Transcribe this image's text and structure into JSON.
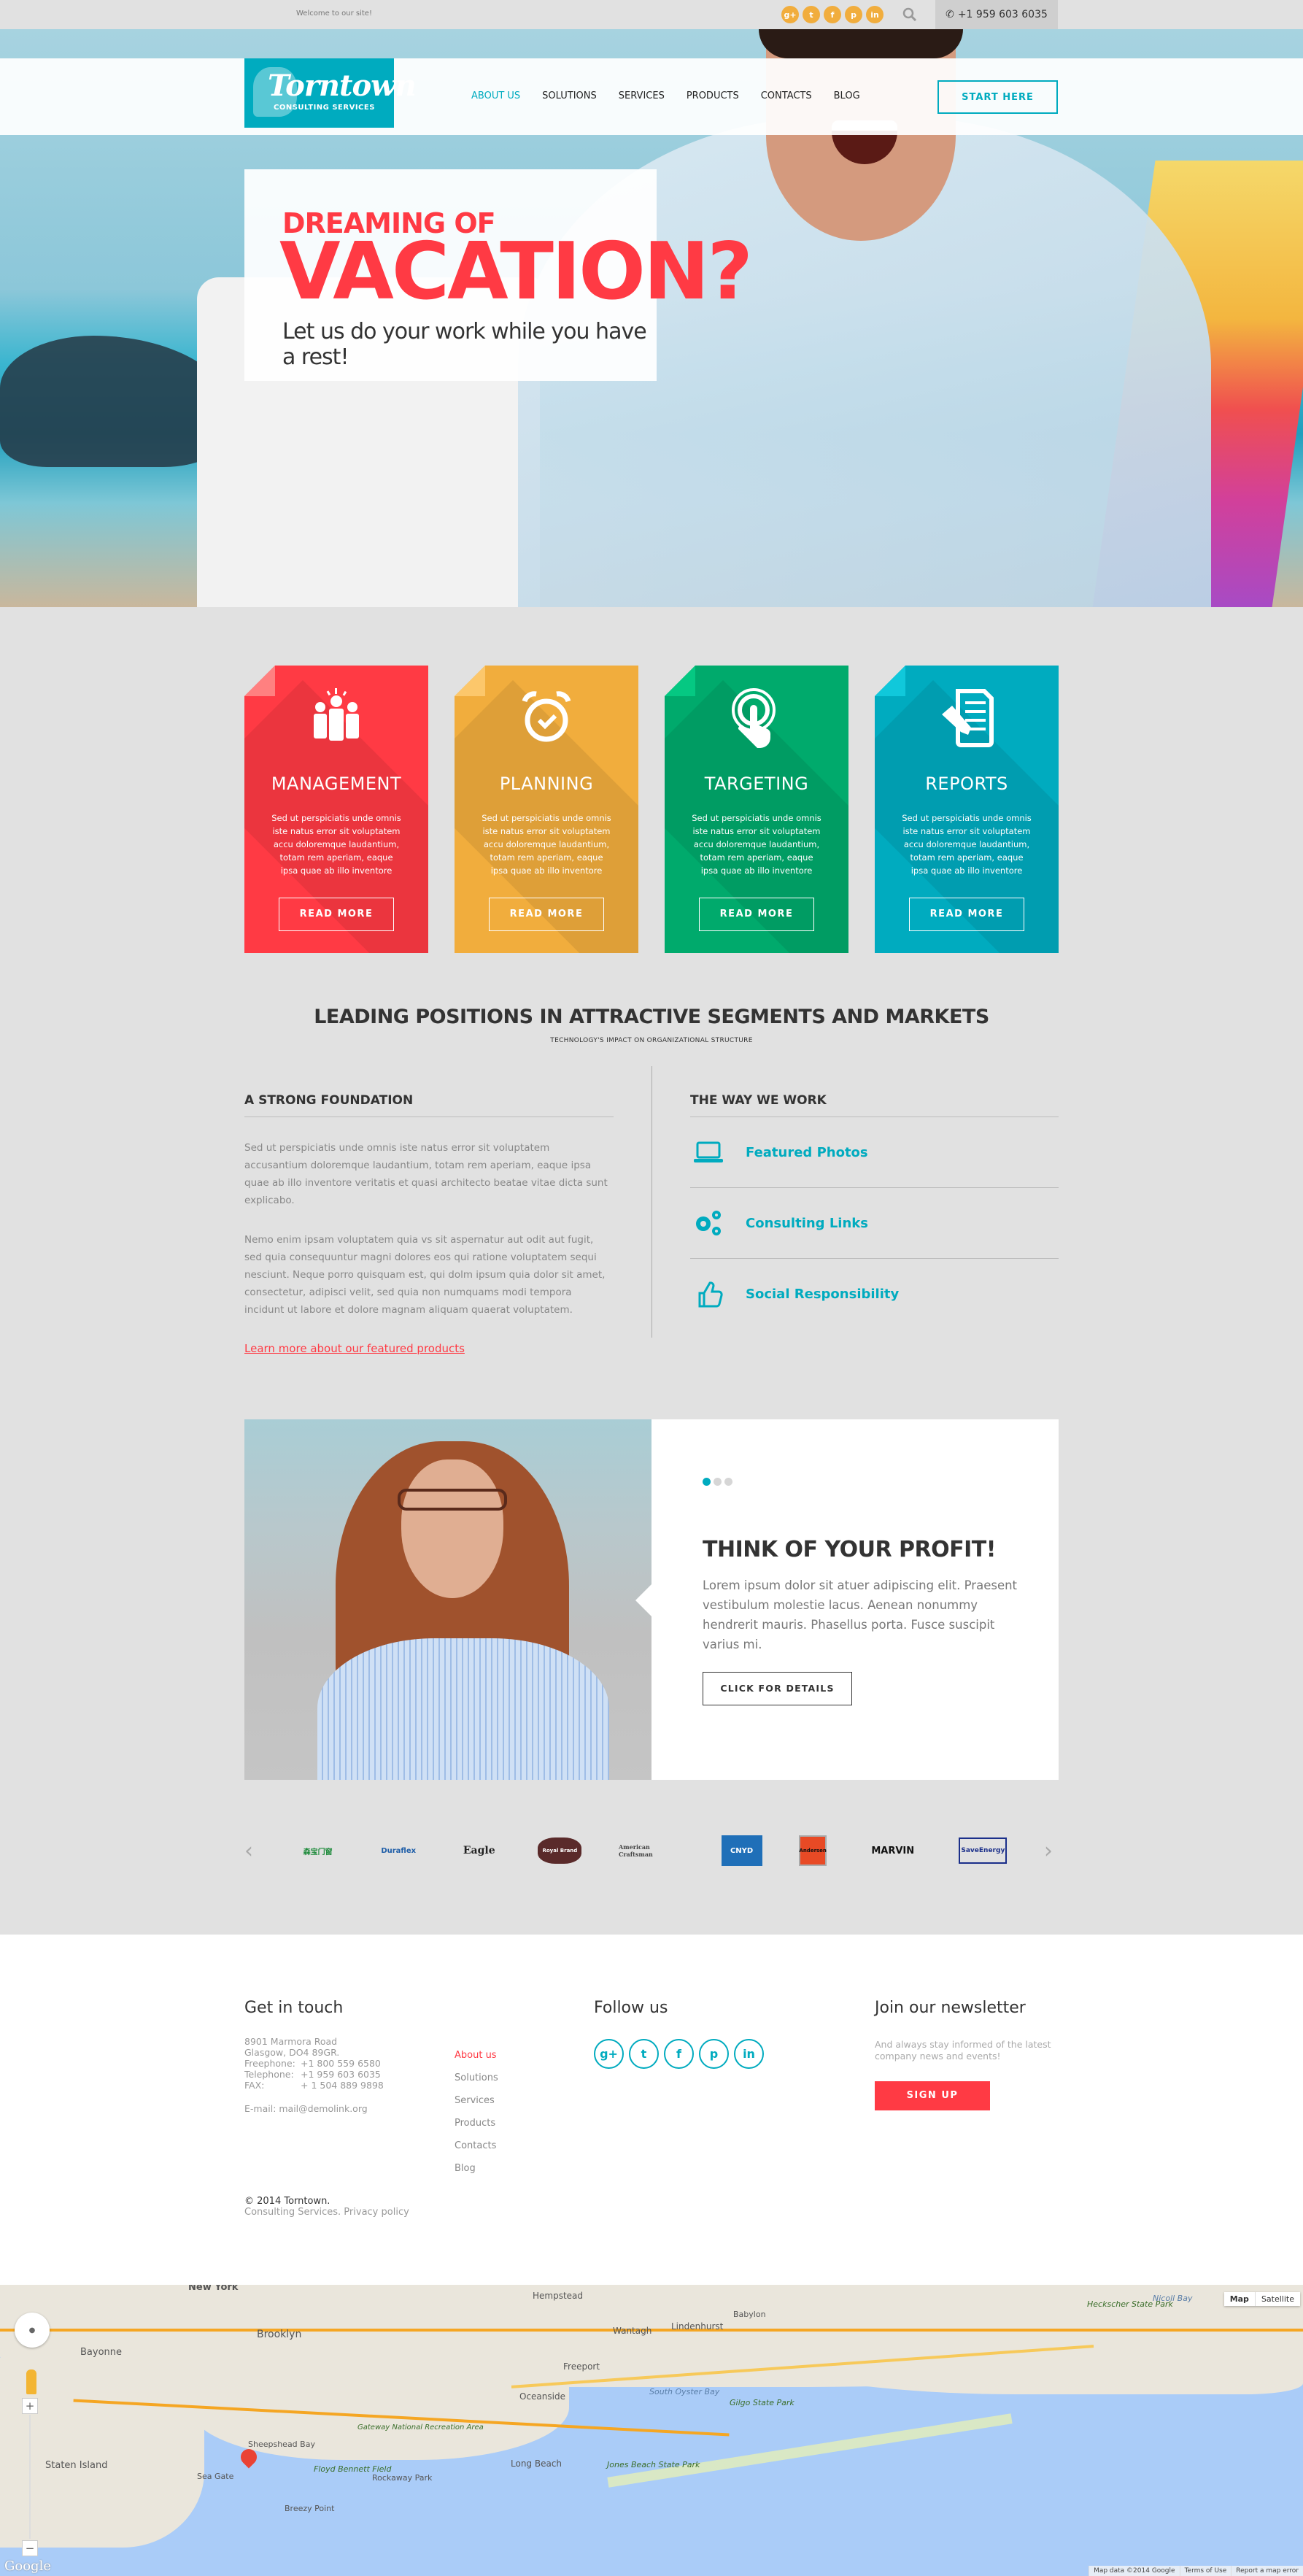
{
  "topbar": {
    "welcome": "Welcome to our site!",
    "social_icons": [
      "google-plus",
      "twitter",
      "facebook",
      "pinterest",
      "linkedin"
    ],
    "social_glyphs": [
      "g+",
      "t",
      "f",
      "p",
      "in"
    ],
    "phone": "+1 959 603 6035"
  },
  "header": {
    "logo_name": "Torntown",
    "logo_tagline": "CONSULTING SERVICES",
    "nav": [
      {
        "label": "ABOUT US",
        "active": true
      },
      {
        "label": "SOLUTIONS",
        "active": false
      },
      {
        "label": "SERVICES",
        "active": false
      },
      {
        "label": "PRODUCTS",
        "active": false
      },
      {
        "label": "CONTACTS",
        "active": false
      },
      {
        "label": "BLOG",
        "active": false
      }
    ],
    "cta": "START HERE"
  },
  "hero": {
    "line1": "DREAMING OF",
    "line2": "VACATION?",
    "line3": "Let us do your work while you have a rest!"
  },
  "features": [
    {
      "title": "MANAGEMENT",
      "icon": "team-icon",
      "color": "#ff3a44",
      "fold": "#ff8080",
      "text": "Sed ut perspiciatis unde omnis iste natus error sit voluptatem accu doloremque laudantium, totam rem aperiam, eaque ipsa quae ab illo inventore",
      "button": "READ MORE"
    },
    {
      "title": "PLANNING",
      "icon": "alarm-clock-icon",
      "color": "#f1ad3d",
      "fold": "#fcc76b",
      "text": "Sed ut perspiciatis unde omnis iste natus error sit voluptatem accu doloremque laudantium, totam rem aperiam, eaque ipsa quae ab illo inventore",
      "button": "READ MORE"
    },
    {
      "title": "TARGETING",
      "icon": "touch-target-icon",
      "color": "#00aa6c",
      "fold": "#05c882",
      "text": "Sed ut perspiciatis unde omnis iste natus error sit voluptatem accu doloremque laudantium, totam rem aperiam, eaque ipsa quae ab illo inventore",
      "button": "READ MORE"
    },
    {
      "title": "REPORTS",
      "icon": "report-document-icon",
      "color": "#00abbf",
      "fold": "#10c8db",
      "text": "Sed ut perspiciatis unde omnis iste natus error sit voluptatem accu doloremque laudantium, totam rem aperiam, eaque ipsa quae ab illo inventore",
      "button": "READ MORE"
    }
  ],
  "leading": {
    "title": "LEADING POSITIONS IN ATTRACTIVE SEGMENTS AND MARKETS",
    "subtitle": "TECHNOLOGY'S IMPACT ON ORGANIZATIONAL STRUCTURE",
    "left": {
      "heading": "A STRONG FOUNDATION",
      "p1": "Sed ut perspiciatis unde omnis iste natus error sit voluptatem accusantium doloremque laudantium, totam rem aperiam, eaque ipsa quae ab illo inventore veritatis et quasi architecto beatae vitae dicta sunt explicabo.",
      "p2": "Nemo enim ipsam voluptatem quia vs sit aspernatur aut odit aut fugit, sed quia consequuntur magni dolores eos qui ratione voluptatem sequi nesciunt. Neque porro quisquam est, qui dolm ipsum quia dolor sit amet, consectetur, adipisci velit, sed quia non numquams modi tempora incidunt ut labore et dolore magnam aliquam quaerat voluptatem.",
      "link": "Learn more about our featured products"
    },
    "right": {
      "heading": "THE WAY WE WORK",
      "items": [
        {
          "label": "Featured Photos",
          "icon": "laptop-icon"
        },
        {
          "label": "Consulting Links",
          "icon": "gears-icon"
        },
        {
          "label": "Social Responsibility",
          "icon": "thumbs-up-icon"
        }
      ]
    }
  },
  "profit": {
    "slides_total": 3,
    "slide_active": 1,
    "title": "THINK OF YOUR PROFIT!",
    "text": "Lorem ipsum dolor sit atuer adipiscing elit. Praesent vestibulum molestie lacus. Aenean nonummy hendrerit mauris. Phasellus porta. Fusce suscipit varius mi.",
    "button": "CLICK FOR DETAILS"
  },
  "brands": {
    "items": [
      "森宝门窗",
      "Duraflex",
      "Eagle",
      "Royal Brand",
      "American Craftsman",
      "CNYD",
      "Andersen",
      "MARVIN",
      "SaveEnergy"
    ],
    "colors": [
      "#1d8a3a",
      "#1f5ea8",
      "#222222",
      "#5a2a2a",
      "#444444",
      "#1f6fb8",
      "#e84a25",
      "#111111",
      "#1b2f8a"
    ]
  },
  "footer": {
    "contact": {
      "heading": "Get in touch",
      "address1": "8901 Marmora Road",
      "address2": "Glasgow, DO4 89GR.",
      "rows": [
        {
          "k": "Freephone:",
          "v": "+1 800 559 6580"
        },
        {
          "k": "Telephone:",
          "v": "+1 959 603 6035"
        },
        {
          "k": "FAX:",
          "v": "+ 1 504 889 9898"
        }
      ],
      "email": "E-mail: mail@demolink.org"
    },
    "links": [
      {
        "label": "About us",
        "active": true
      },
      {
        "label": "Solutions",
        "active": false
      },
      {
        "label": "Services",
        "active": false
      },
      {
        "label": "Products",
        "active": false
      },
      {
        "label": "Contacts",
        "active": false
      },
      {
        "label": "Blog",
        "active": false
      }
    ],
    "follow": {
      "heading": "Follow us",
      "icons": [
        "google-plus",
        "twitter",
        "facebook",
        "pinterest",
        "linkedin"
      ],
      "glyphs": [
        "g+",
        "t",
        "f",
        "p",
        "in"
      ]
    },
    "newsletter": {
      "heading": "Join our newsletter",
      "text": "And always stay informed of the latest company news and events!",
      "button": "SIGN UP"
    },
    "copyright": "© 2014 Torntown.",
    "sub": "Consulting Services. Privacy policy"
  },
  "map": {
    "type_options": [
      "Map",
      "Satellite"
    ],
    "type_selected": "Map",
    "attribution": [
      "Map data ©2014 Google",
      "Terms of Use",
      "Report a map error"
    ],
    "logo": "Google",
    "labels": [
      "New York",
      "Brooklyn",
      "Bayonne",
      "Staten Island",
      "Sea Gate",
      "Sheepshead Bay",
      "Floyd Bennett Field",
      "Breezy Point",
      "Rockaway Park",
      "Gateway National Recreation Area",
      "Hempstead",
      "Freeport",
      "Long Beach",
      "Jones Beach State Park",
      "Gilgo State Park",
      "Babylon",
      "Lindenhurst",
      "Oceanside",
      "Wantagh",
      "South Oyster Bay",
      "Heckscher State Park",
      "Nicoll Bay"
    ]
  }
}
